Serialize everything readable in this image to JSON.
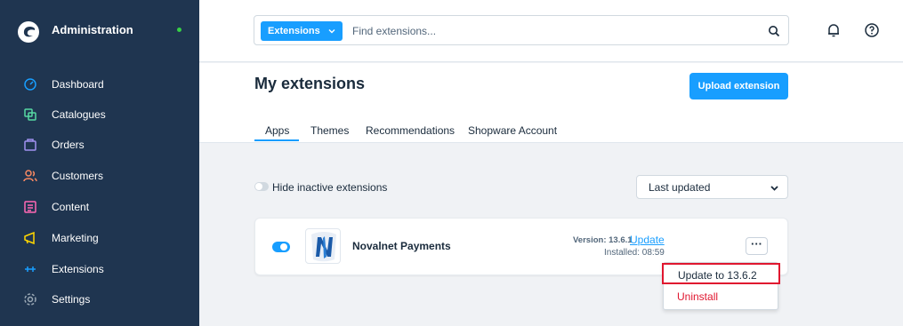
{
  "sidebar": {
    "title": "Administration",
    "items": [
      {
        "label": "Dashboard",
        "icon": "dashboard-icon"
      },
      {
        "label": "Catalogues",
        "icon": "catalogues-icon"
      },
      {
        "label": "Orders",
        "icon": "orders-icon"
      },
      {
        "label": "Customers",
        "icon": "customers-icon"
      },
      {
        "label": "Content",
        "icon": "content-icon"
      },
      {
        "label": "Marketing",
        "icon": "marketing-icon"
      },
      {
        "label": "Extensions",
        "icon": "extensions-icon"
      },
      {
        "label": "Settings",
        "icon": "settings-icon"
      }
    ]
  },
  "search": {
    "type_label": "Extensions",
    "placeholder": "Find extensions..."
  },
  "page": {
    "title": "My extensions",
    "upload_label": "Upload extension",
    "tabs": [
      "Apps",
      "Themes",
      "Recommendations",
      "Shopware Account"
    ],
    "active_tab": "Apps"
  },
  "filters": {
    "hide_inactive_label": "Hide inactive extensions",
    "sort_value": "Last updated"
  },
  "extension": {
    "name": "Novalnet Payments",
    "version_label": "Version: 13.6.1",
    "update_link": "Update",
    "installed": "Installed: 08:59",
    "more_label": "···"
  },
  "context_menu": {
    "update": "Update to 13.6.2",
    "uninstall": "Uninstall"
  },
  "colors": {
    "sidebar_bg": "#1f3550",
    "accent": "#189eff",
    "danger": "#e0162f",
    "status_online": "#37d046"
  }
}
